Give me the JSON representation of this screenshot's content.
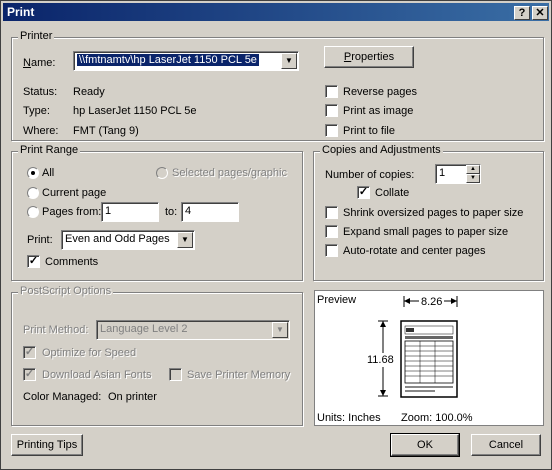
{
  "window": {
    "title": "Print",
    "help_btn": "?",
    "close_btn": "✕"
  },
  "printer": {
    "legend": "Printer",
    "name_label": "Name:",
    "name_value": "\\\\fmtnamtv\\hp LaserJet 1150 PCL 5e",
    "properties_btn": "Properties",
    "status_label": "Status:",
    "status_value": "Ready",
    "type_label": "Type:",
    "type_value": "hp LaserJet 1150 PCL 5e",
    "where_label": "Where:",
    "where_value": "FMT (Tang 9)",
    "reverse_pages": "Reverse pages",
    "print_as_image": "Print as image",
    "print_to_file": "Print to file"
  },
  "range": {
    "legend": "Print Range",
    "all": "All",
    "current_page": "Current page",
    "pages_from": "Pages from:",
    "from_value": "1",
    "to_label": "to:",
    "to_value": "4",
    "selected": "Selected pages/graphic",
    "print_label": "Print:",
    "print_value": "Even and Odd Pages",
    "comments": "Comments"
  },
  "copies": {
    "legend": "Copies and Adjustments",
    "number_label": "Number of copies:",
    "number_value": "1",
    "collate": "Collate",
    "shrink": "Shrink oversized pages to paper size",
    "expand": "Expand small pages to paper size",
    "autorotate": "Auto-rotate and center pages"
  },
  "postscript": {
    "legend": "PostScript Options",
    "method_label": "Print Method:",
    "method_value": "Language Level 2",
    "optimize": "Optimize for Speed",
    "download_fonts": "Download Asian Fonts",
    "save_memory": "Save Printer Memory",
    "color_label": "Color Managed:",
    "color_value": "On printer"
  },
  "preview": {
    "label": "Preview",
    "width": "8.26",
    "height": "11.68",
    "units": "Units: Inches",
    "zoom": "Zoom: 100.0%"
  },
  "footer": {
    "tips": "Printing Tips",
    "ok": "OK",
    "cancel": "Cancel"
  }
}
